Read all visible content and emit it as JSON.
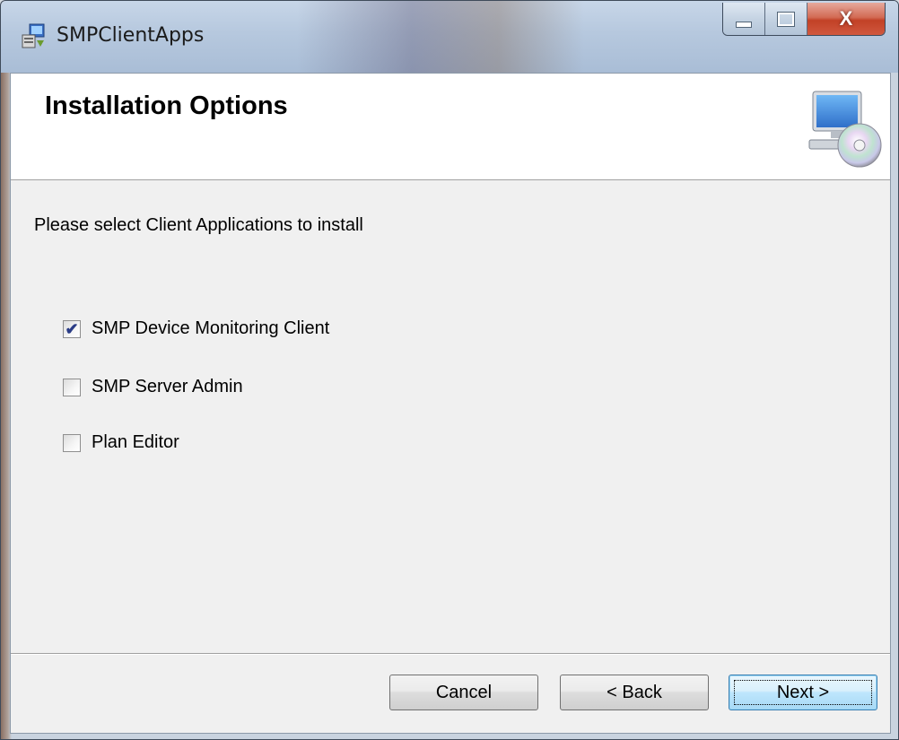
{
  "window": {
    "title": "SMPClientApps",
    "icon": "installer-icon",
    "controls": {
      "minimize_icon": "minimize-icon",
      "maximize_icon": "maximize-icon",
      "close_label": "X"
    }
  },
  "banner": {
    "title": "Installation Options",
    "icon": "computer-cd-icon"
  },
  "instruction": "Please select Client Applications to install",
  "options": [
    {
      "label": "SMP Device Monitoring Client",
      "checked": true
    },
    {
      "label": "SMP Server Admin",
      "checked": false
    },
    {
      "label": "Plan Editor",
      "checked": false
    }
  ],
  "buttons": {
    "cancel": "Cancel",
    "back": "< Back",
    "next": "Next >"
  },
  "colors": {
    "close_button": "#c24126",
    "checkmark": "#2a3c86",
    "default_button_border": "#3c7fb1"
  }
}
